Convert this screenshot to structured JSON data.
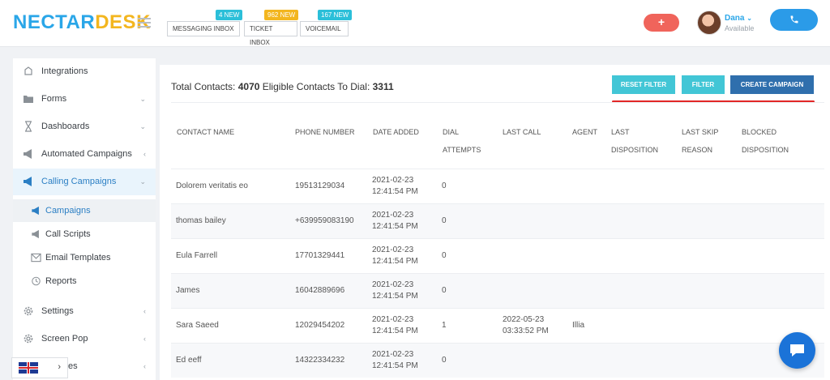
{
  "brand": {
    "part1": "NECTAR",
    "part2": "DESK"
  },
  "inboxes": [
    {
      "label": "Messaging Inbox",
      "badge": "4 NEW",
      "badge_color": "#2bbfd9"
    },
    {
      "label": "Ticket Inbox",
      "badge": "962 NEW",
      "badge_color": "#f3b61f"
    },
    {
      "label": "Voicemail",
      "badge": "167 NEW",
      "badge_color": "#2bbfd9"
    }
  ],
  "header": {
    "plus_label": "+",
    "user_name": "Dana",
    "user_status": "Available"
  },
  "sidebar": {
    "items": [
      {
        "label": "Integrations",
        "icon": "puzzle-icon",
        "chevron": ""
      },
      {
        "label": "Forms",
        "icon": "folder-icon",
        "chevron": "⌄"
      },
      {
        "label": "Dashboards",
        "icon": "hourglass-icon",
        "chevron": "⌄"
      },
      {
        "label": "Automated Campaigns",
        "icon": "megaphone-icon",
        "chevron": "‹"
      },
      {
        "label": "Calling Campaigns",
        "icon": "megaphone-icon",
        "chevron": "⌄"
      },
      {
        "label": "Settings",
        "icon": "gear-icon",
        "chevron": "‹"
      },
      {
        "label": "Screen Pop",
        "icon": "gear-icon",
        "chevron": "‹"
      },
      {
        "label": "es",
        "icon": "",
        "chevron": "‹"
      }
    ],
    "sub_items": [
      {
        "label": "Campaigns",
        "icon": "megaphone-icon"
      },
      {
        "label": "Call Scripts",
        "icon": "megaphone-icon"
      },
      {
        "label": "Email Templates",
        "icon": "envelope-icon"
      },
      {
        "label": "Reports",
        "icon": "clock-icon"
      }
    ]
  },
  "language": {
    "arrow": "›"
  },
  "main": {
    "totals": {
      "total_label": "Total Contacts:",
      "total_value": "4070",
      "eligible_label": "Eligible Contacts To Dial:",
      "eligible_value": "3311"
    },
    "buttons": {
      "reset": "Reset Filter",
      "filter": "Filter",
      "create": "Create Campaign"
    },
    "columns": [
      {
        "line1": "",
        "line2": "Contact Name"
      },
      {
        "line1": "",
        "line2": "Phone Number"
      },
      {
        "line1": "",
        "line2": "Date Added"
      },
      {
        "line1": "Dial",
        "line2": "Attempts"
      },
      {
        "line1": "",
        "line2": "Last Call"
      },
      {
        "line1": "",
        "line2": "Agent"
      },
      {
        "line1": "Last",
        "line2": "Disposition"
      },
      {
        "line1": "Last Skip",
        "line2": "Reason"
      },
      {
        "line1": "Blocked",
        "line2": "Disposition"
      }
    ],
    "rows": [
      {
        "name": "Dolorem veritatis eo",
        "phone": "19513129034",
        "date1": "2021-02-23",
        "date2": "12:41:54 PM",
        "attempts": "0",
        "call1": "",
        "call2": "",
        "agent": ""
      },
      {
        "name": "thomas bailey",
        "phone": "+639959083190",
        "date1": "2021-02-23",
        "date2": "12:41:54 PM",
        "attempts": "0",
        "call1": "",
        "call2": "",
        "agent": ""
      },
      {
        "name": "Eula Farrell",
        "phone": "17701329441",
        "date1": "2021-02-23",
        "date2": "12:41:54 PM",
        "attempts": "0",
        "call1": "",
        "call2": "",
        "agent": ""
      },
      {
        "name": "James",
        "phone": "16042889696",
        "date1": "2021-02-23",
        "date2": "12:41:54 PM",
        "attempts": "0",
        "call1": "",
        "call2": "",
        "agent": ""
      },
      {
        "name": "Sara Saeed",
        "phone": "12029454202",
        "date1": "2021-02-23",
        "date2": "12:41:54 PM",
        "attempts": "1",
        "call1": "2022-05-23",
        "call2": "03:33:52 PM",
        "agent": "Illia"
      },
      {
        "name": "Ed eeff",
        "phone": "14322334232",
        "date1": "2021-02-23",
        "date2": "12:41:54 PM",
        "attempts": "0",
        "call1": "",
        "call2": "",
        "agent": ""
      }
    ]
  },
  "colors": {
    "accent": "#2aa6e8",
    "brand_yellow": "#f3b61f",
    "filter_button": "#42c6d6",
    "create_button": "#2f6fad",
    "highlight": "#e22626"
  }
}
